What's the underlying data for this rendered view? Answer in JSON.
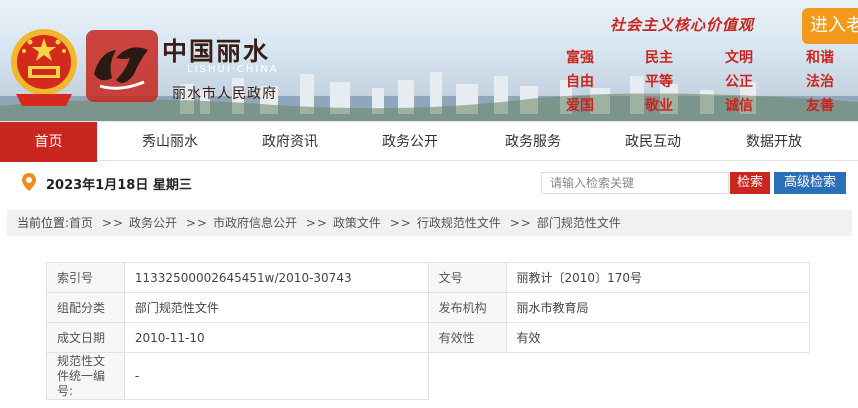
{
  "header": {
    "brand_cn": "中国丽水",
    "brand_pinyin": "LISHUI·CHINA",
    "brand_sub": "丽水市人民政府",
    "slogan": "社会主义核心价值观",
    "enter_button": "进入老",
    "values": [
      [
        "富强",
        "自由",
        "爱国"
      ],
      [
        "民主",
        "平等",
        "敬业"
      ],
      [
        "文明",
        "公正",
        "诚信"
      ],
      [
        "和谐",
        "法治",
        "友善"
      ]
    ]
  },
  "nav": {
    "items": [
      {
        "label": "首页",
        "active": true
      },
      {
        "label": "秀山丽水",
        "active": false
      },
      {
        "label": "政府资讯",
        "active": false
      },
      {
        "label": "政务公开",
        "active": false
      },
      {
        "label": "政务服务",
        "active": false
      },
      {
        "label": "政民互动",
        "active": false
      },
      {
        "label": "数据开放",
        "active": false
      }
    ]
  },
  "infobar": {
    "date": "2023年1月18日 星期三",
    "search_placeholder": "请输入检索关键",
    "search_button": "检索",
    "advanced_button": "高级检索"
  },
  "breadcrumb": {
    "prefix": "当前位置:",
    "items": [
      "首页",
      "政务公开",
      "市政府信息公开",
      "政策文件",
      "行政规范性文件",
      "部门规范性文件"
    ],
    "separator": ">>"
  },
  "meta": {
    "index_label": "索引号",
    "index_value": "11332500002645451w/2010-30743",
    "docno_label": "文号",
    "docno_value": "丽教计〔2010〕170号",
    "category_label": "组配分类",
    "category_value": "部门规范性文件",
    "publisher_label": "发布机构",
    "publisher_value": "丽水市教育局",
    "date_label": "成文日期",
    "date_value": "2010-11-10",
    "validity_label": "有效性",
    "validity_value": "有效",
    "unified_label": "规范性文件统一编号:",
    "unified_value": "-"
  },
  "colors": {
    "primary_red": "#c8261e",
    "advanced_blue": "#2a6fb8",
    "slogan_orange": "#f39a1e"
  }
}
